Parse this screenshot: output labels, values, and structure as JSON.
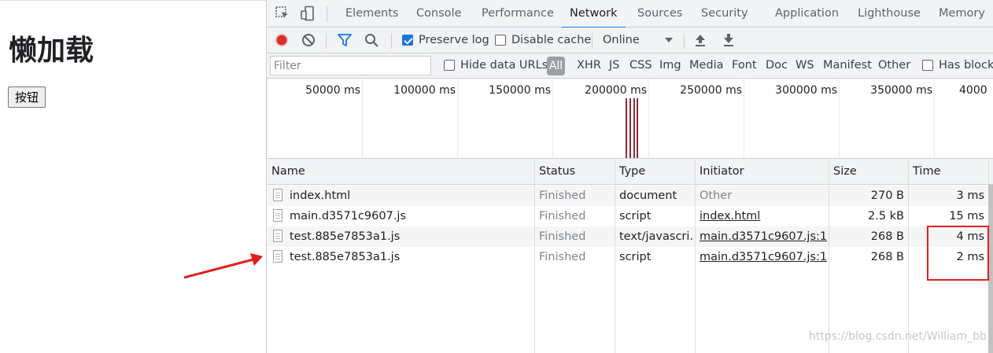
{
  "page": {
    "heading": "懒加载",
    "button_label": "按钮"
  },
  "devtools": {
    "tabs": [
      "Elements",
      "Console",
      "Performance",
      "Network",
      "Sources",
      "Security",
      "Application",
      "Lighthouse",
      "Memory"
    ],
    "active_tab": "Network",
    "toolbar": {
      "preserve_log": "Preserve log",
      "preserve_log_checked": true,
      "disable_cache": "Disable cache",
      "disable_cache_checked": false,
      "throttling": "Online"
    },
    "filter": {
      "placeholder": "Filter",
      "hide_data_urls": "Hide data URLs",
      "types": [
        "All",
        "XHR",
        "JS",
        "CSS",
        "Img",
        "Media",
        "Font",
        "Doc",
        "WS",
        "Manifest",
        "Other"
      ],
      "has_blocked": "Has blocke"
    },
    "overview": {
      "ticks": [
        "50000 ms",
        "100000 ms",
        "150000 ms",
        "200000 ms",
        "250000 ms",
        "300000 ms",
        "350000 ms",
        "4000"
      ]
    },
    "columns": [
      "Name",
      "Status",
      "Type",
      "Initiator",
      "Size",
      "Time"
    ],
    "rows": [
      {
        "name": "index.html",
        "status": "Finished",
        "type": "document",
        "initiator": "Other",
        "initiator_link": false,
        "size": "270 B",
        "time": "3 ms"
      },
      {
        "name": "main.d3571c9607.js",
        "status": "Finished",
        "type": "script",
        "initiator": "index.html",
        "initiator_link": true,
        "size": "2.5 kB",
        "time": "15 ms"
      },
      {
        "name": "test.885e7853a1.js",
        "status": "Finished",
        "type": "text/javascri...",
        "initiator": "main.d3571c9607.js:1",
        "initiator_link": true,
        "size": "268 B",
        "time": "4 ms"
      },
      {
        "name": "test.885e7853a1.js",
        "status": "Finished",
        "type": "script",
        "initiator": "main.d3571c9607.js:1",
        "initiator_link": true,
        "size": "268 B",
        "time": "2 ms"
      }
    ]
  },
  "watermark": "https://blog.csdn.net/William_bb",
  "colors": {
    "accent": "#1a73e8",
    "record": "#d93025",
    "annotation": "#e02020"
  }
}
